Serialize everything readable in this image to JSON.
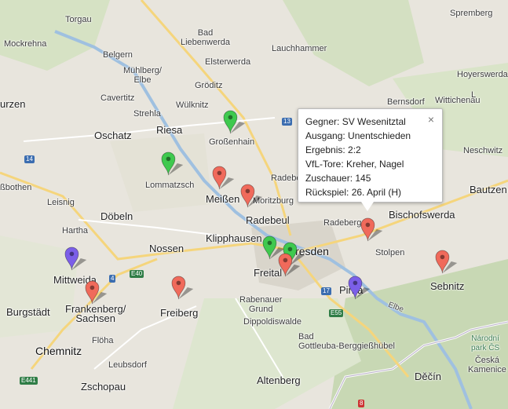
{
  "places": [
    {
      "id": "torgau",
      "label": "Torgau"
    },
    {
      "id": "mockrehna",
      "label": "Mockrehna"
    },
    {
      "id": "bad-liebenwerda",
      "label": "Bad\nLiebenwerda"
    },
    {
      "id": "belgern",
      "label": "Belgern"
    },
    {
      "id": "lauchhammer",
      "label": "Lauchhammer"
    },
    {
      "id": "spremberg",
      "label": "Spremberg"
    },
    {
      "id": "elsterwerda",
      "label": "Elsterwerda"
    },
    {
      "id": "muehlberg",
      "label": "Mühlberg/\nElbe"
    },
    {
      "id": "groeditz",
      "label": "Gröditz"
    },
    {
      "id": "cavertitz",
      "label": "Cavertitz"
    },
    {
      "id": "wuelknitz",
      "label": "Wülknitz"
    },
    {
      "id": "strehla",
      "label": "Strehla"
    },
    {
      "id": "riesa",
      "label": "Riesa"
    },
    {
      "id": "wurzen",
      "label": "urzen"
    },
    {
      "id": "oschatz",
      "label": "Oschatz"
    },
    {
      "id": "grossenhain",
      "label": "Großenhain"
    },
    {
      "id": "lommatzsch",
      "label": "Lommatzsch"
    },
    {
      "id": "meissen",
      "label": "Meißen"
    },
    {
      "id": "moritzburg",
      "label": "Moritzburg"
    },
    {
      "id": "radebeul",
      "label": "Radebeul"
    },
    {
      "id": "bothen",
      "label": "ßbothen"
    },
    {
      "id": "leisnig",
      "label": "Leisnig"
    },
    {
      "id": "doebeln",
      "label": "Döbeln"
    },
    {
      "id": "hartha",
      "label": "Hartha"
    },
    {
      "id": "nossen",
      "label": "Nossen"
    },
    {
      "id": "klipphausen",
      "label": "Klipphausen"
    },
    {
      "id": "dresden",
      "label": "Dresden"
    },
    {
      "id": "freital",
      "label": "Freital"
    },
    {
      "id": "mittweida",
      "label": "Mittweida"
    },
    {
      "id": "frankenberg",
      "label": "Frankenberg/\nSachsen"
    },
    {
      "id": "freiberg",
      "label": "Freiberg"
    },
    {
      "id": "burgstaedt",
      "label": "Burgstädt"
    },
    {
      "id": "rabenauer",
      "label": "Rabenauer\nGrund"
    },
    {
      "id": "dippoldiswalde",
      "label": "Dippoldiswalde"
    },
    {
      "id": "chemnitz",
      "label": "Chemnitz"
    },
    {
      "id": "floeha",
      "label": "Flöha"
    },
    {
      "id": "leubsdorf",
      "label": "Leubsdorf"
    },
    {
      "id": "zschopau",
      "label": "Zschopau"
    },
    {
      "id": "altenberg",
      "label": "Altenberg"
    },
    {
      "id": "bad-gottleuba",
      "label": "Bad\nGottleuba-Berggießhübel"
    },
    {
      "id": "pirna",
      "label": "Pirna"
    },
    {
      "id": "stolpen",
      "label": "Stolpen"
    },
    {
      "id": "radeberg",
      "label": "Radeberg"
    },
    {
      "id": "bischofswerda",
      "label": "Bischofswerda"
    },
    {
      "id": "bautzen",
      "label": "Bautzen"
    },
    {
      "id": "neschwitz",
      "label": "Neschwitz"
    },
    {
      "id": "bernsdorf",
      "label": "Bernsdorf"
    },
    {
      "id": "wittichenau",
      "label": "Wittichenau"
    },
    {
      "id": "hoyerswerda",
      "label": "Hoyerswerda"
    },
    {
      "id": "lohsa",
      "label": "L"
    },
    {
      "id": "sebnitz",
      "label": "Sebnitz"
    },
    {
      "id": "narodni",
      "label": "Národní\npark ČS"
    },
    {
      "id": "ceska-kamenice",
      "label": "Česká\nKamenice"
    },
    {
      "id": "decin",
      "label": "Děčín"
    },
    {
      "id": "radebe",
      "label": "Radebe"
    },
    {
      "id": "elbe",
      "label": "Elbe"
    }
  ],
  "road_shields": [
    {
      "id": "a14",
      "label": "14",
      "kind": "blue"
    },
    {
      "id": "a13",
      "label": "13",
      "kind": "blue"
    },
    {
      "id": "a4",
      "label": "4",
      "kind": "blue"
    },
    {
      "id": "a17",
      "label": "17",
      "kind": "blue"
    },
    {
      "id": "e40",
      "label": "E40",
      "kind": "green"
    },
    {
      "id": "e55",
      "label": "E55",
      "kind": "green"
    },
    {
      "id": "e441",
      "label": "E441",
      "kind": "green"
    },
    {
      "id": "r8",
      "label": "8",
      "kind": "red"
    }
  ],
  "markers": [
    {
      "id": "grossenhain",
      "color": "#3fc94e",
      "result": "win"
    },
    {
      "id": "lommatzsch",
      "color": "#3fc94e",
      "result": "win"
    },
    {
      "id": "meissen-1",
      "color": "#f06a5b",
      "result": "loss"
    },
    {
      "id": "meissen-2",
      "color": "#f06a5b",
      "result": "loss"
    },
    {
      "id": "wesenitztal",
      "color": "#f06a5b",
      "result": "loss"
    },
    {
      "id": "dresden-1",
      "color": "#3fc94e",
      "result": "win"
    },
    {
      "id": "dresden-2",
      "color": "#3fc94e",
      "result": "win"
    },
    {
      "id": "freital",
      "color": "#f06a5b",
      "result": "loss"
    },
    {
      "id": "pirna",
      "color": "#7b5fe8",
      "result": "draw"
    },
    {
      "id": "sebnitz",
      "color": "#f06a5b",
      "result": "loss"
    },
    {
      "id": "mittweida",
      "color": "#7b5fe8",
      "result": "draw"
    },
    {
      "id": "frankenberg",
      "color": "#f06a5b",
      "result": "loss"
    },
    {
      "id": "freiberg",
      "color": "#f06a5b",
      "result": "loss"
    }
  ],
  "info": {
    "rows": [
      {
        "key": "Gegner:",
        "value": " SV Wesenitztal"
      },
      {
        "key": "Ausgang:",
        "value": " Unentschieden"
      },
      {
        "key": "Ergebnis:",
        "value": " 2:2"
      },
      {
        "key": "VfL-Tore:",
        "value": " Kreher, Nagel"
      },
      {
        "key": "Zuschauer:",
        "value": " 145"
      },
      {
        "key": "Rückspiel:",
        "value": " 26. April (H)"
      }
    ],
    "close_label": "×"
  }
}
